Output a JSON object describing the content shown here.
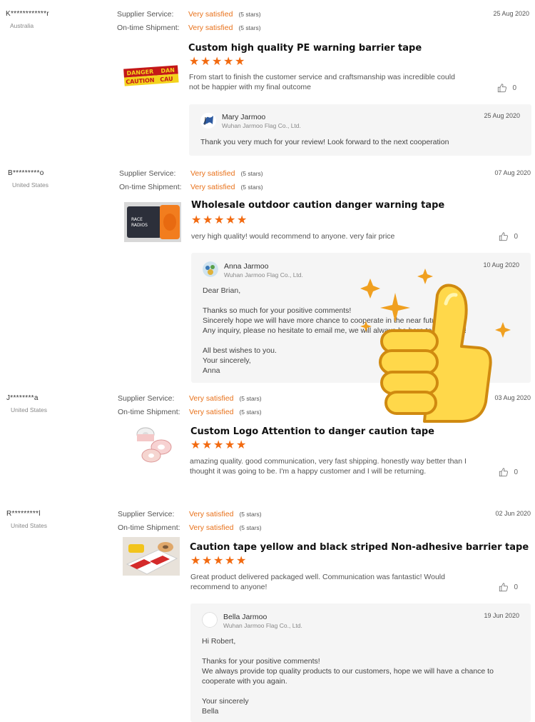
{
  "labels": {
    "supplier_service": "Supplier Service:",
    "ontime_shipment": "On-time Shipment:"
  },
  "colors": {
    "accent": "#e8711a",
    "star": "#f26a10",
    "reply_bg": "#f5f5f5"
  },
  "reviews": [
    {
      "reviewer": "K************r",
      "country": "Australia",
      "supplier_rating": "Very satisfied",
      "supplier_stars": "(5 stars)",
      "shipment_rating": "Very satisfied",
      "shipment_stars": "(5 stars)",
      "date": "25 Aug 2020",
      "product_title": "Custom high quality PE warning barrier tape",
      "rating": 5,
      "text": "From start to finish the customer service and craftsmanship was incredible could not be happier with my final outcome",
      "likes": "0",
      "reply": {
        "name": "Mary Jarmoo",
        "company": "Wuhan Jarmoo Flag Co., Ltd.",
        "date": "25 Aug 2020",
        "body": "Thank you very much for your review! Look forward to the next cooperation"
      }
    },
    {
      "reviewer": "B*********o",
      "country": "United States",
      "supplier_rating": "Very satisfied",
      "supplier_stars": "(5 stars)",
      "shipment_rating": "Very satisfied",
      "shipment_stars": "(5 stars)",
      "date": "07 Aug 2020",
      "product_title": "Wholesale outdoor caution danger warning tape",
      "rating": 5,
      "text": "very high quality! would recommend to anyone. very fair price",
      "likes": "0",
      "reply": {
        "name": "Anna Jarmoo",
        "company": "Wuhan Jarmoo Flag Co., Ltd.",
        "date": "10 Aug 2020",
        "body": "Dear Brian,\n\nThanks so much for your positive comments!\nSincerely hope we will have more chance to cooperate in the near future.\nAny inquiry, please no hesitate to email me, we will always be here to help you !\n\nAll best wishes to you.\nYour sincerely,\nAnna"
      }
    },
    {
      "reviewer": "J********a",
      "country": "United States",
      "supplier_rating": "Very satisfied",
      "supplier_stars": "(5 stars)",
      "shipment_rating": "Very satisfied",
      "shipment_stars": "(5 stars)",
      "date": "03 Aug 2020",
      "product_title": "Custom Logo Attention to danger caution tape",
      "rating": 5,
      "text": "amazing quality. good communication, very fast shipping.  honestly way better than I thought it was going to be. I'm a happy customer and I will be returning.",
      "likes": "0"
    },
    {
      "reviewer": "R*********l",
      "country": "United States",
      "supplier_rating": "Very satisfied",
      "supplier_stars": "(5 stars)",
      "shipment_rating": "Very satisfied",
      "shipment_stars": "(5 stars)",
      "date": "02 Jun 2020",
      "product_title": "Caution tape yellow and black striped Non-adhesive barrier tape",
      "rating": 5,
      "text": "Great product delivered packaged well.  Communication was fantastic!  Would recommend to anyone!",
      "likes": "0",
      "reply": {
        "name": "Bella Jarmoo",
        "company": "Wuhan Jarmoo Flag Co., Ltd.",
        "date": "19 Jun 2020",
        "body": "Hi Robert,\n\nThanks for your positive comments!\nWe always provide top quality products to our customers, hope we will have a chance to cooperate with you again.\n\nYour sincerely\nBella"
      }
    }
  ]
}
